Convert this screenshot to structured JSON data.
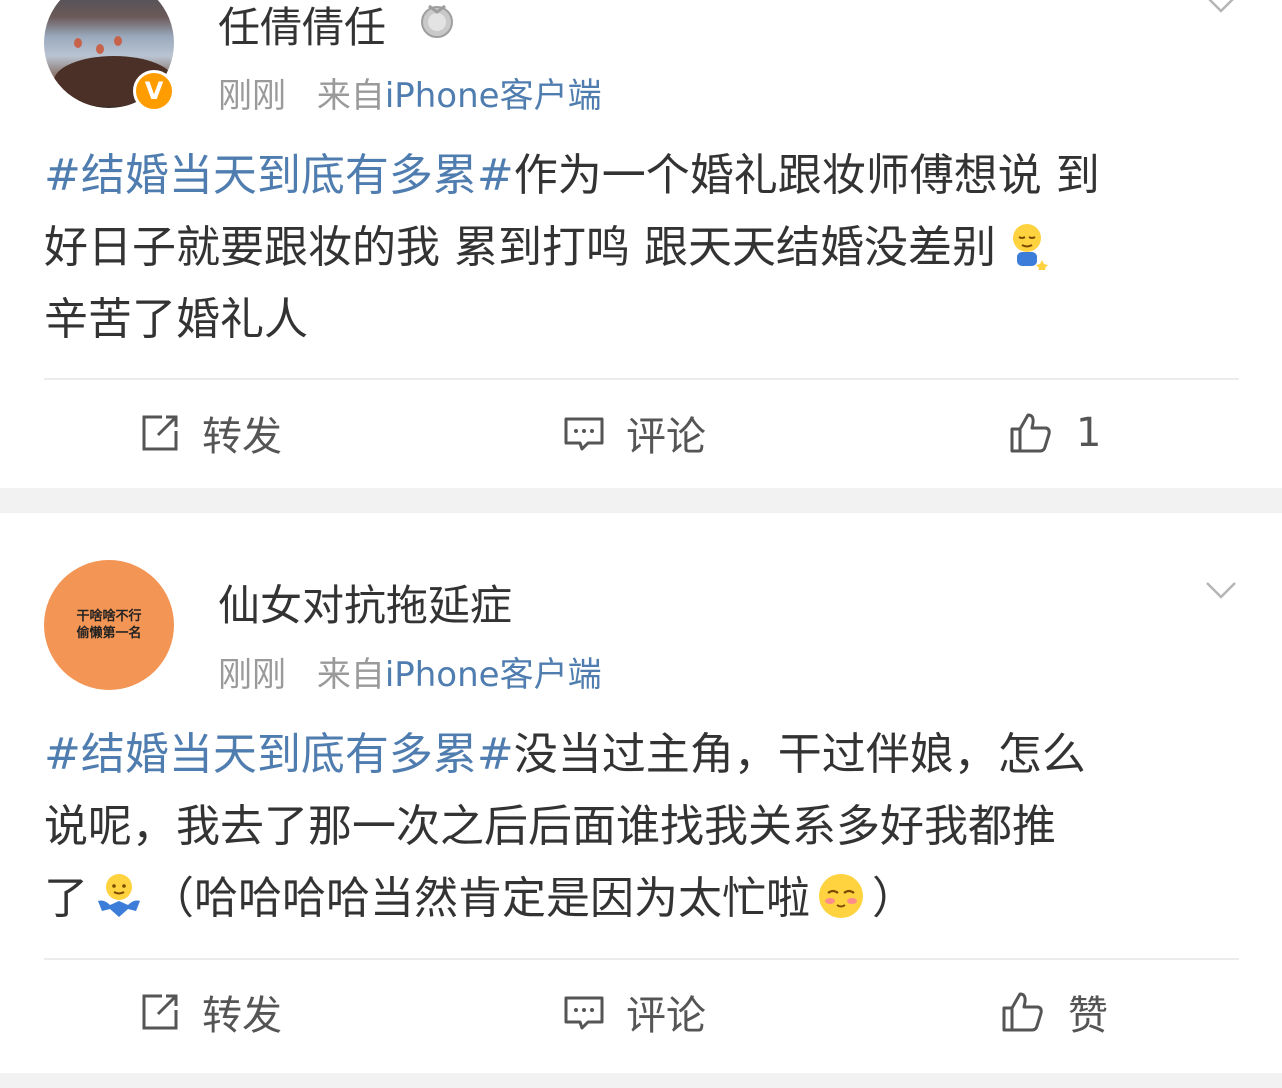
{
  "posts": [
    {
      "username": "任倩倩任",
      "time": "刚刚",
      "from_prefix": "来自",
      "source": "iPhone客户端",
      "hashtag": "#结婚当天到底有多累#",
      "content_lines": [
        "作为一个婚礼跟妆师傅想说 到",
        "好日子就要跟妆的我 累到打鸣 跟天天结婚没差别",
        "辛苦了婚礼人"
      ],
      "emoji": "sleepy-emoji",
      "actions": {
        "repost": "转发",
        "comment": "评论",
        "like": "1"
      }
    },
    {
      "username": "仙女对抗拖延症",
      "avatar_text": [
        "干啥啥不行",
        "偷懒第一名"
      ],
      "time": "刚刚",
      "from_prefix": "来自",
      "source": "iPhone客户端",
      "hashtag": "#结婚当天到底有多累#",
      "content_lines": [
        "没当过主角，干过伴娘，怎么",
        "说呢，我去了那一次之后后面谁找我关系多好我都推",
        "了",
        "（哈哈哈哈当然肯定是因为太忙啦",
        "）"
      ],
      "emojis": [
        "shrug-emoji",
        "blush-emoji"
      ],
      "actions": {
        "repost": "转发",
        "comment": "评论",
        "like": "赞"
      }
    }
  ],
  "colors": {
    "link": "#507daf",
    "meta_text": "#9a9a9a",
    "verified_badge": "#ff9c00",
    "avatar2_bg": "#f39555",
    "page_bg": "#f2f2f2"
  },
  "icons": {
    "verified": "verified-badge-icon",
    "medal": "medal-icon",
    "menu": "chevron-down-icon",
    "repost": "repost-icon",
    "comment": "comment-icon",
    "like": "thumbs-up-icon"
  }
}
